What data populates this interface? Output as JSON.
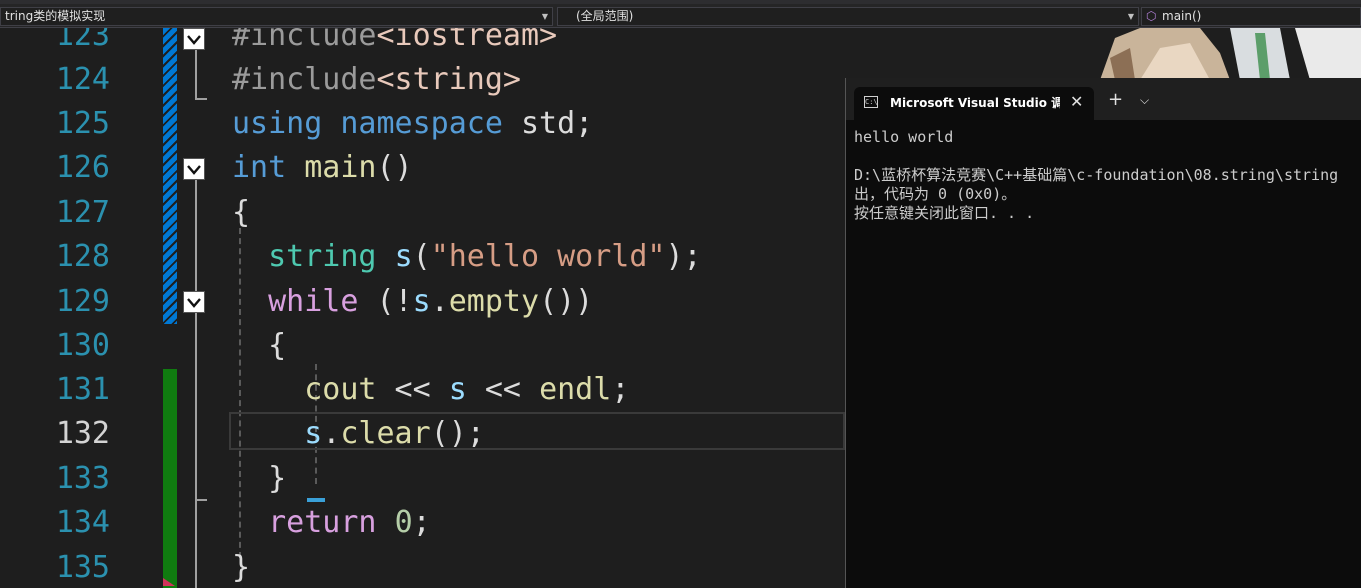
{
  "navbar": {
    "scope_label": "tring类的模拟实现",
    "global_scope": "(全局范围)",
    "function": "main()"
  },
  "editor": {
    "lines": [
      {
        "num": "123"
      },
      {
        "num": "124"
      },
      {
        "num": "125"
      },
      {
        "num": "126"
      },
      {
        "num": "127"
      },
      {
        "num": "128"
      },
      {
        "num": "129"
      },
      {
        "num": "130"
      },
      {
        "num": "131"
      },
      {
        "num": "132"
      },
      {
        "num": "133"
      },
      {
        "num": "134"
      },
      {
        "num": "135"
      }
    ],
    "code": {
      "l123_inc": "#include",
      "l123_hdr": "<iostream>",
      "l124_inc": "#include",
      "l124_hdr": "<string>",
      "l125_using": "using",
      "l125_ns": "namespace",
      "l125_rest": " std;",
      "l126_int": "int",
      "l126_main": "main",
      "l126_paren": "()",
      "l127": "{",
      "l128_type": "string",
      "l128_var": "s",
      "l128_open": "(",
      "l128_str": "\"hello world\"",
      "l128_close": ");",
      "l129_while": "while",
      "l129_a": " (!",
      "l129_var": "s",
      "l129_dot": ".",
      "l129_fn": "empty",
      "l129_b": "())",
      "l130": "{",
      "l131_fn": "cout",
      "l131_op": " << ",
      "l131_var": "s",
      "l131_op2": " << ",
      "l131_endl": "endl",
      "l131_semi": ";",
      "l132_var": "s",
      "l132_dot": ".",
      "l132_fn": "clear",
      "l132_rest": "();",
      "l133": "}",
      "l134_ret": "return",
      "l134_num": "0",
      "l134_semi": ";",
      "l135": "}"
    }
  },
  "console": {
    "tab_title": "Microsoft Visual Studio 调试控制台",
    "icon_text": "C:\\",
    "close": "✕",
    "new_tab": "+",
    "dropdown": "⌵",
    "output": [
      "hello world",
      "",
      "D:\\蓝桥杯算法竞赛\\C++基础篇\\c-foundation\\08.string\\string",
      "出，代码为 0 (0x0)。",
      "按任意键关闭此窗口. . ."
    ]
  },
  "colors": {
    "editor_bg": "#1e1e1e",
    "line_number": "#2b91af",
    "keyword": "#569cd6",
    "control": "#d8a0df",
    "string": "#d69d85",
    "function": "#dcdcaa",
    "variable": "#9cdcfe",
    "type": "#4ec9b0",
    "console_bg": "#0c0c0c"
  }
}
